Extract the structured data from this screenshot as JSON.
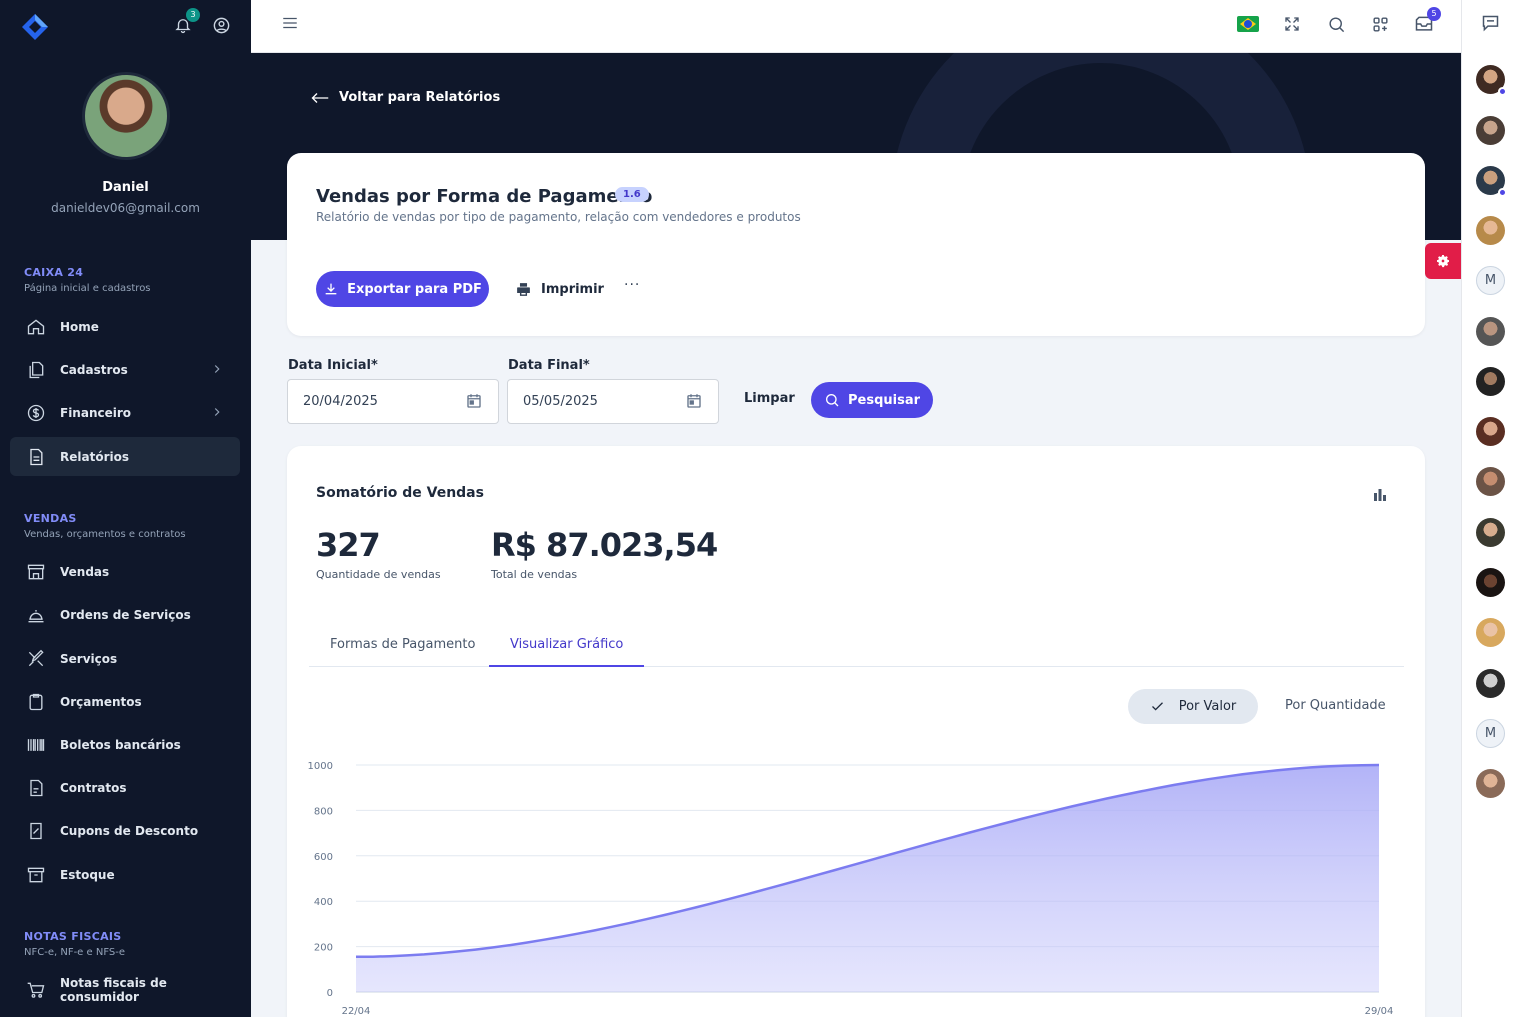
{
  "sidebar": {
    "notifications_count": "3",
    "user": {
      "name": "Daniel",
      "email": "danieldev06@gmail.com"
    },
    "sections": [
      {
        "title": "CAIXA 24",
        "subtitle": "Página inicial e cadastros"
      },
      {
        "title": "VENDAS",
        "subtitle": "Vendas, orçamentos e contratos"
      },
      {
        "title": "NOTAS FISCAIS",
        "subtitle": "NFC-e, NF-e e NFS-e"
      }
    ],
    "items": [
      {
        "label": "Home",
        "icon": "home-icon"
      },
      {
        "label": "Cadastros",
        "icon": "files-icon"
      },
      {
        "label": "Financeiro",
        "icon": "dollar-icon"
      },
      {
        "label": "Relatórios",
        "icon": "report-icon"
      },
      {
        "label": "Vendas",
        "icon": "store-icon"
      },
      {
        "label": "Ordens de Serviços",
        "icon": "service-bell-icon"
      },
      {
        "label": "Serviços",
        "icon": "tools-icon"
      },
      {
        "label": "Orçamentos",
        "icon": "clipboard-icon"
      },
      {
        "label": "Boletos bancários",
        "icon": "barcode-icon"
      },
      {
        "label": "Contratos",
        "icon": "contract-icon"
      },
      {
        "label": "Cupons de Desconto",
        "icon": "coupon-icon"
      },
      {
        "label": "Estoque",
        "icon": "archive-icon"
      },
      {
        "label": "Notas fiscais de consumidor",
        "icon": "cart-icon"
      }
    ]
  },
  "topbar": {
    "messages_count": "5"
  },
  "rail": {
    "letters": [
      "M",
      "M"
    ]
  },
  "page": {
    "back_label": "Voltar para Relatórios",
    "title": "Vendas por Forma de Pagamento",
    "version": "1.6",
    "description": "Relatório de vendas por tipo de pagamento, relação com vendedores e produtos",
    "export_label": "Exportar para PDF",
    "print_label": "Imprimir",
    "more_label": "···"
  },
  "filters": {
    "start_label": "Data Inicial*",
    "start_value": "20/04/2025",
    "end_label": "Data Final*",
    "end_value": "05/05/2025",
    "clear_label": "Limpar",
    "search_label": "Pesquisar"
  },
  "report": {
    "title": "Somatório de Vendas",
    "qty_value": "327",
    "qty_label": "Quantidade de vendas",
    "total_value": "R$ 87.023,54",
    "total_label": "Total de vendas",
    "tabs": [
      "Formas de Pagamento",
      "Visualizar Gráfico"
    ],
    "toggle_on": "Por Valor",
    "toggle_off": "Por Quantidade"
  },
  "chart_data": {
    "type": "area",
    "x": [
      "22/04",
      "29/04"
    ],
    "values": [
      155,
      1000
    ],
    "ylim": [
      0,
      1000
    ],
    "yticks": [
      0,
      200,
      400,
      600,
      800,
      1000
    ],
    "grid": true,
    "color": "#7c7cf0"
  }
}
